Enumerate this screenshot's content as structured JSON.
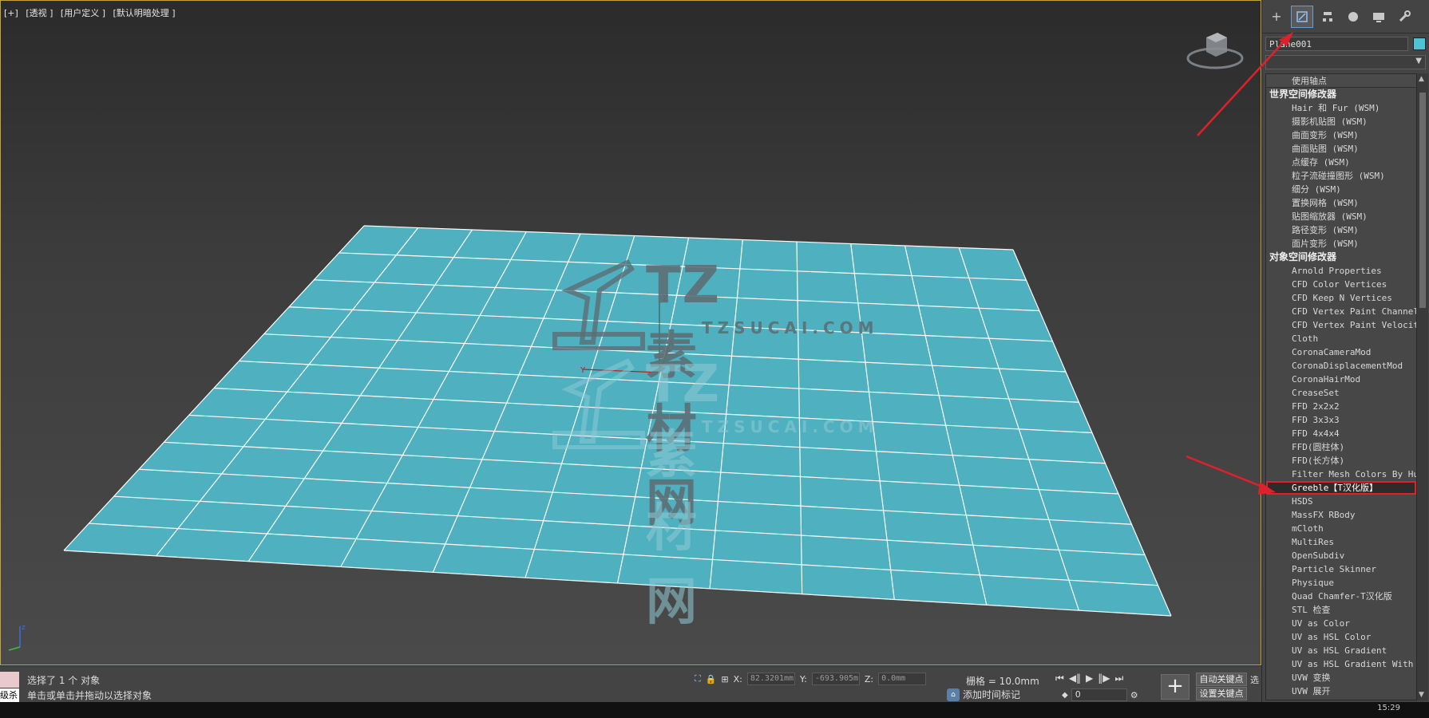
{
  "viewport": {
    "labels": [
      "[+]",
      "[透视 ]",
      "[用户定义 ]",
      "[默认明暗处理 ]"
    ],
    "watermark_main": "TZ素材网",
    "watermark_sub": "TZSUCAI.COM",
    "axis_x": "X",
    "axis_y": "Y",
    "axis_z": "Z",
    "plane_color": "#4fb0c0",
    "grid_color": "#ffffff"
  },
  "panel": {
    "object_name": "Plane001",
    "object_color": "#4ec3d6",
    "use_pivot": "使用轴点",
    "world_header": "世界空间修改器",
    "world_items": [
      "Hair 和 Fur (WSM)",
      "摄影机贴图 (WSM)",
      "曲面变形 (WSM)",
      "曲面贴图 (WSM)",
      "点缓存 (WSM)",
      "粒子流碰撞图形 (WSM)",
      "细分 (WSM)",
      "置换网格 (WSM)",
      "贴图缩放器 (WSM)",
      "路径变形 (WSM)",
      "面片变形 (WSM)"
    ],
    "object_header": "对象空间修改器",
    "object_items": [
      "Arnold Properties",
      "CFD Color Vertices",
      "CFD Keep N Vertices",
      "CFD Vertex Paint Channel",
      "CFD Vertex Paint Velocity",
      "Cloth",
      "CoronaCameraMod",
      "CoronaDisplacementMod",
      "CoronaHairMod",
      "CreaseSet",
      "FFD 2x2x2",
      "FFD 3x3x3",
      "FFD 4x4x4",
      "FFD(圆柱体)",
      "FFD(长方体)",
      "Filter Mesh Colors By Hue",
      "Greeble【T汉化版】",
      "HSDS",
      "MassFX RBody",
      "mCloth",
      "MultiRes",
      "OpenSubdiv",
      "Particle Skinner",
      "Physique",
      "Quad Chamfer-T汉化版",
      "STL 检查",
      "UV as Color",
      "UV as HSL Color",
      "UV as HSL Gradient",
      "UV as HSL Gradient With Mi",
      "UVW 变换",
      "UVW 展开"
    ],
    "selected_item": "Greeble【T汉化版】"
  },
  "status": {
    "left_text": "级杀",
    "selection": "选择了 1 个 对象",
    "hint": "单击或单击并拖动以选择对象",
    "x_label": "X:",
    "x_value": "82.3201mm",
    "y_label": "Y:",
    "y_value": "-693.905m",
    "z_label": "Z:",
    "z_value": "0.0mm",
    "grid": "栅格 = 10.0mm",
    "add_time_tag": "添加时间标记",
    "frame": "0",
    "auto_key": "自动关键点",
    "set_key": "设置关键点",
    "extra": "选"
  },
  "taskbar": {
    "clock": "15:29"
  }
}
